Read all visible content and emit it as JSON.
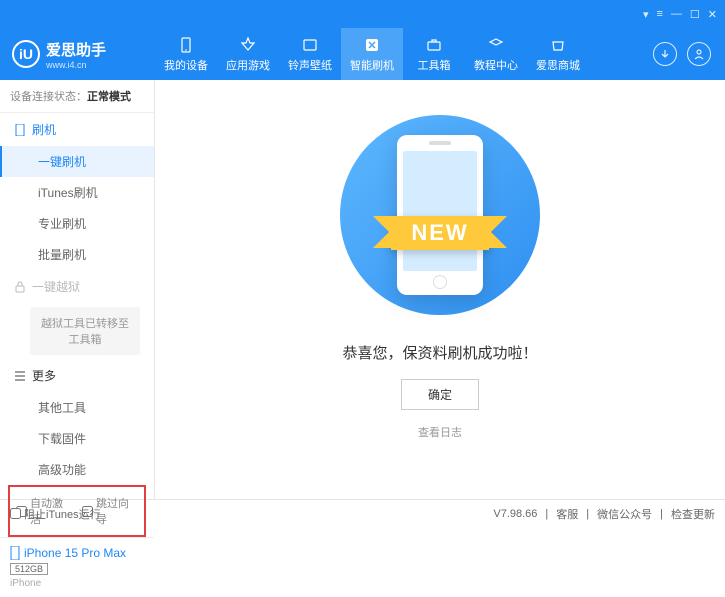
{
  "titlebar": {
    "icons": [
      "skin",
      "menu",
      "min",
      "max",
      "close"
    ]
  },
  "header": {
    "logo_letter": "iU",
    "app_name": "爱思助手",
    "app_url": "www.i4.cn",
    "nav": [
      {
        "label": "我的设备"
      },
      {
        "label": "应用游戏"
      },
      {
        "label": "铃声壁纸"
      },
      {
        "label": "智能刷机"
      },
      {
        "label": "工具箱"
      },
      {
        "label": "教程中心"
      },
      {
        "label": "爱思商城"
      }
    ]
  },
  "sidebar": {
    "status_label": "设备连接状态：",
    "status_value": "正常模式",
    "sec_flash": "刷机",
    "items_flash": [
      "一键刷机",
      "iTunes刷机",
      "专业刷机",
      "批量刷机"
    ],
    "sec_jail": "一键越狱",
    "jail_notice": "越狱工具已转移至工具箱",
    "sec_more": "更多",
    "items_more": [
      "其他工具",
      "下载固件",
      "高级功能"
    ],
    "chk1": "自动激活",
    "chk2": "跳过向导",
    "device_name": "iPhone 15 Pro Max",
    "device_storage": "512GB",
    "device_type": "iPhone"
  },
  "content": {
    "ribbon": "NEW",
    "message": "恭喜您，保资料刷机成功啦！",
    "ok": "确定",
    "log": "查看日志"
  },
  "footer": {
    "block_itunes": "阻止iTunes运行",
    "version": "V7.98.66",
    "links": [
      "客服",
      "微信公众号",
      "检查更新"
    ]
  }
}
